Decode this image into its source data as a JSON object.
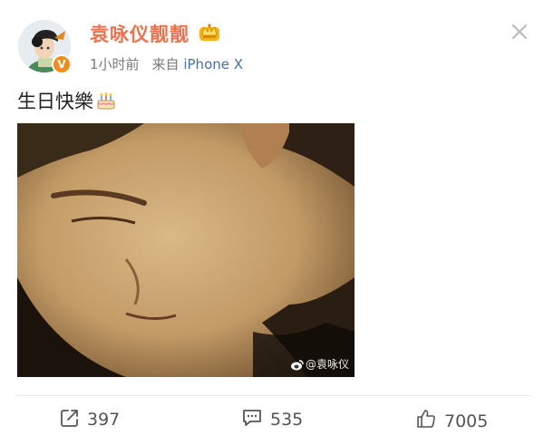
{
  "author": {
    "name": "袁咏仪靓靓",
    "avatar_icon": "avatar-photo",
    "verified_badge_icon": "verified-v-icon",
    "verified_badge_text": "V",
    "member_badge_icon": "crown-badge-icon"
  },
  "meta": {
    "time": "1小时前",
    "source_prefix": "来自",
    "device": "iPhone X"
  },
  "post": {
    "text": "生日快樂",
    "emoji_icon": "birthday-cake-icon",
    "image_watermark": "@袁咏仪"
  },
  "actions": {
    "repost_count": "397",
    "comment_count": "535",
    "like_count": "7005"
  },
  "colors": {
    "username": "#eb7350",
    "device_link": "#4a6ea8",
    "meta": "#7a7a7a",
    "verified": "#f08c1c"
  }
}
